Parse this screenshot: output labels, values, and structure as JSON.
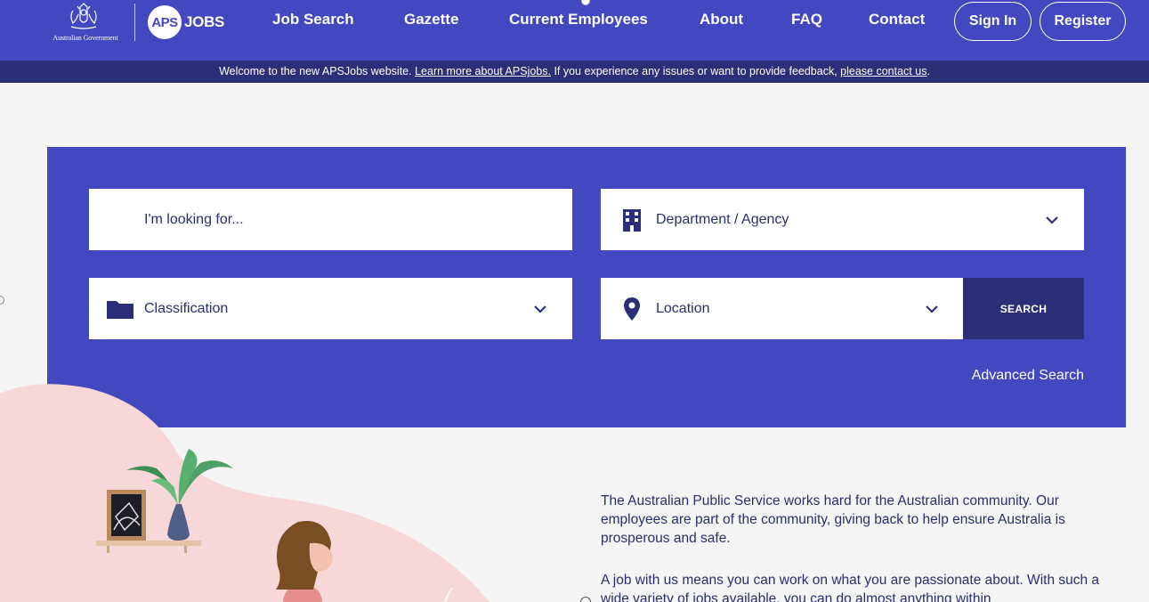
{
  "header": {
    "gov_logo_text": "Australian Government",
    "aps_logo_circle": "APS",
    "aps_logo_text": "JOBS",
    "nav": {
      "job_search": "Job Search",
      "gazette": "Gazette",
      "current_employees": "Current Employees",
      "about": "About",
      "faq": "FAQ",
      "contact": "Contact"
    },
    "sign_in": "Sign In",
    "register": "Register"
  },
  "notice": {
    "text_before": "Welcome to the new APSJobs website. ",
    "link_learn": "Learn more about APSjobs.",
    "text_middle": " If you experience any issues or want to provide feedback, ",
    "link_contact": "please contact us",
    "text_after": "."
  },
  "search": {
    "keyword_placeholder": "I'm looking for...",
    "department_label": "Department / Agency",
    "classification_label": "Classification",
    "location_label": "Location",
    "search_button": "SEARCH",
    "advanced_search": "Advanced Search"
  },
  "icons": {
    "department": "building-icon",
    "classification": "folder-icon",
    "location": "map-pin-icon",
    "dropdown": "chevron-down-icon"
  },
  "colors": {
    "brand": "#4347c0",
    "brand_dark": "#2b2f78",
    "text": "#2a2f6b",
    "illustration_pink": "#f8d7d9"
  },
  "content": {
    "paragraph_1": "The Australian Public Service works hard for the Australian community. Our employees are part of the community, giving back to help ensure Australia is prosperous and safe.",
    "paragraph_2": "A job with us means you can work on what you are passionate about. With such a wide variety of jobs available, you can do almost anything within"
  }
}
